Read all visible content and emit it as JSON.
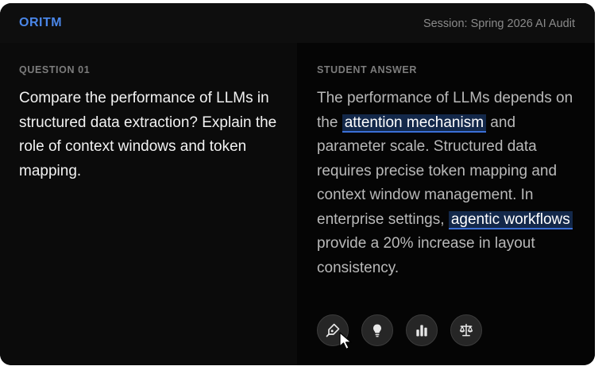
{
  "header": {
    "logo": "ORITM",
    "session": "Session: Spring 2026 AI Audit"
  },
  "question": {
    "label": "QUESTION 01",
    "text": "Compare the performance of LLMs in structured data extraction? Explain the role of context windows and token mapping."
  },
  "answer": {
    "label": "STUDENT ANSWER",
    "part1": "The performance of LLMs depends on the ",
    "highlight1": "attention mechanism",
    "part2": " and parameter scale. Structured data requires precise token mapping and context window management. In enterprise settings, ",
    "highlight2": "agentic workflows",
    "part3": " provide a 20% increase in layout consistency."
  },
  "tools": [
    {
      "icon": "pen-nib-icon"
    },
    {
      "icon": "lightbulb-icon"
    },
    {
      "icon": "bar-chart-icon"
    },
    {
      "icon": "balance-scale-icon"
    }
  ],
  "colors": {
    "accent": "#4a86e8",
    "highlight_bg": "#13284a",
    "highlight_border": "#3b6fd6"
  }
}
